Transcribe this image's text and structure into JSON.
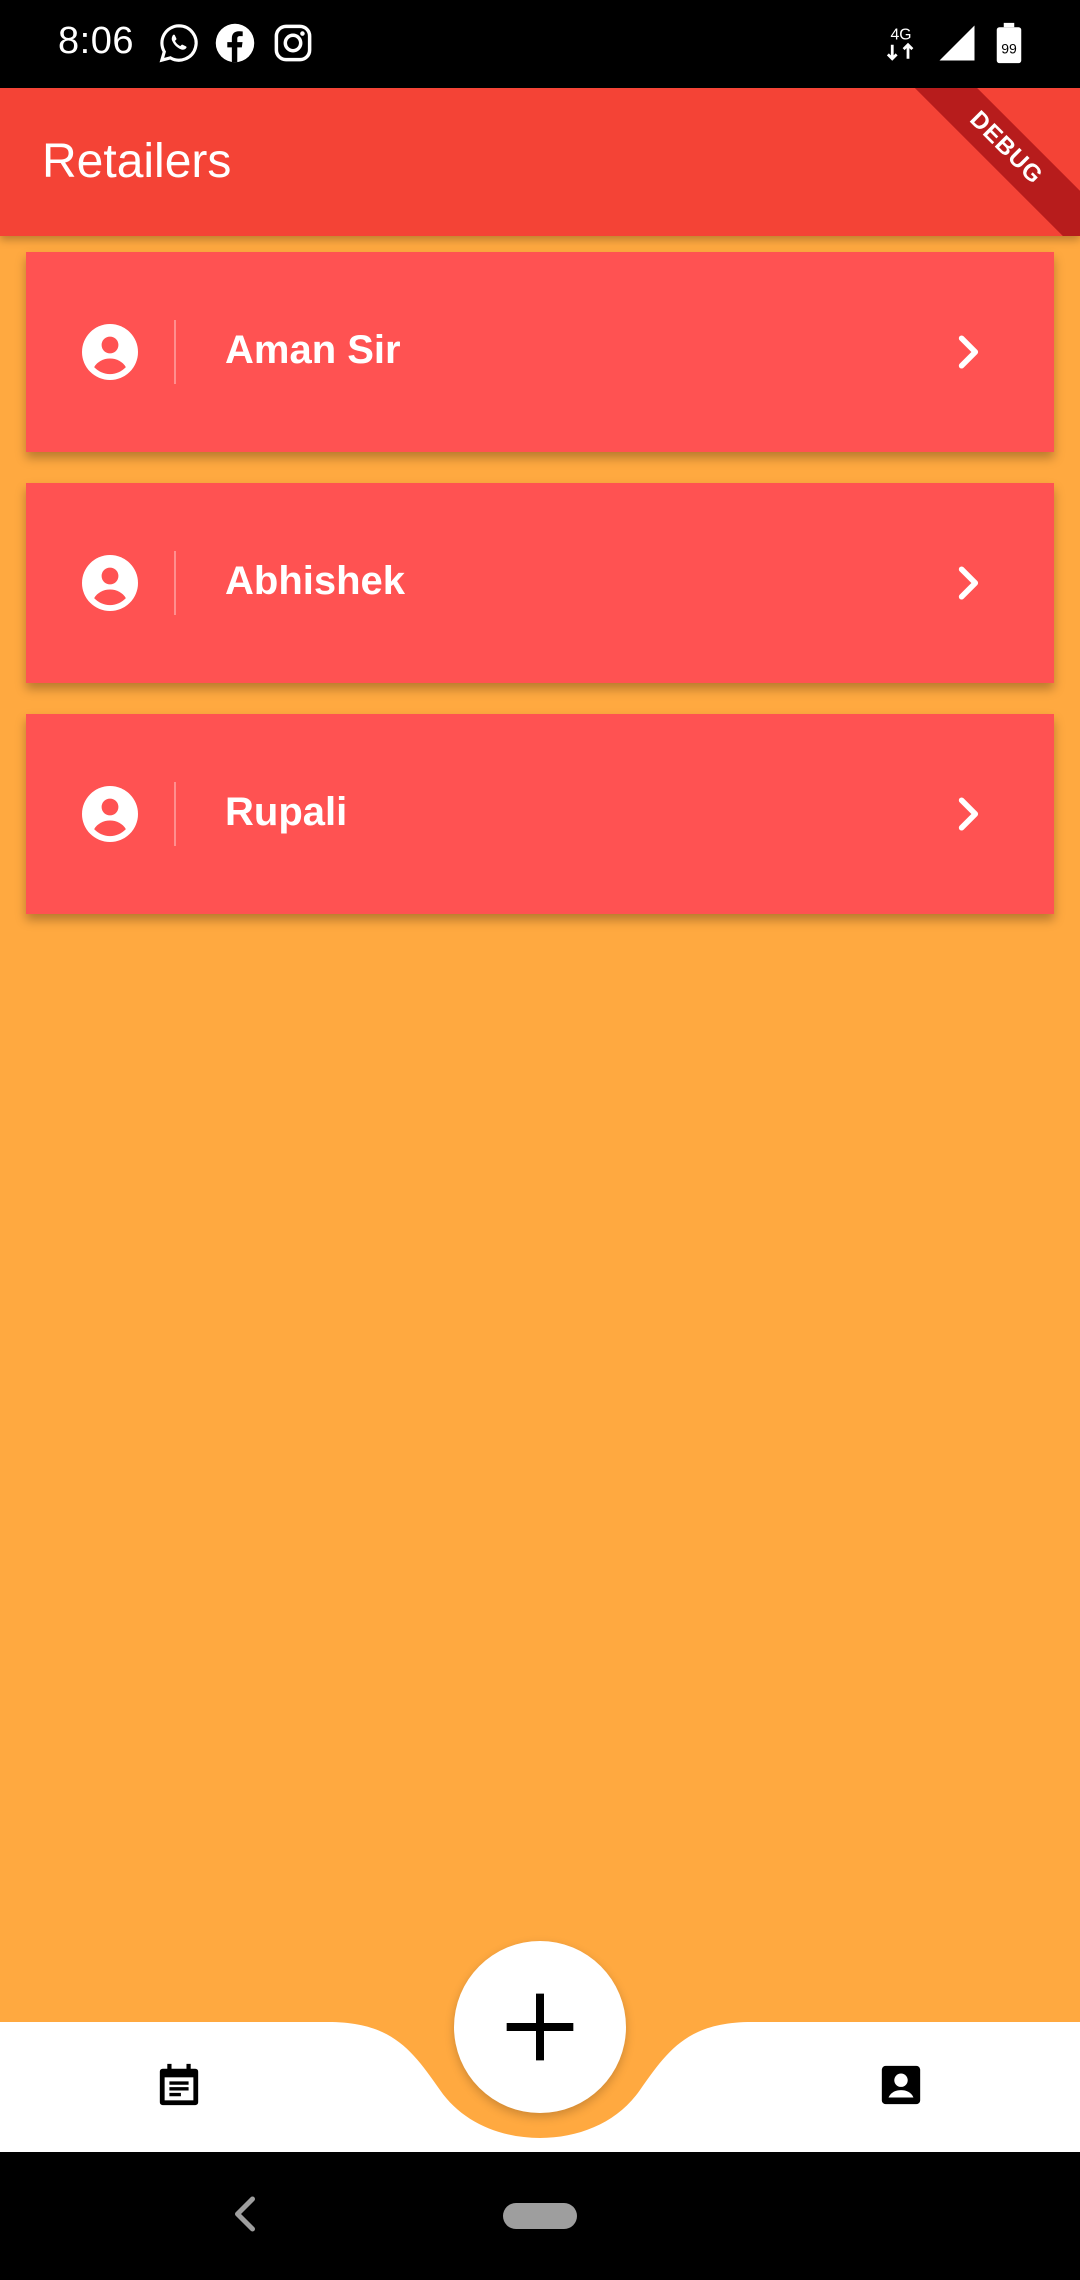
{
  "status_bar": {
    "time": "8:06",
    "app_icons": [
      "whatsapp-icon",
      "facebook-icon",
      "instagram-icon"
    ],
    "network": "4G",
    "battery": "99"
  },
  "app_bar": {
    "title": "Retailers",
    "debug_label": "DEBUG"
  },
  "retailers": [
    {
      "name": "Aman Sir"
    },
    {
      "name": "Abhishek"
    },
    {
      "name": "Rupali"
    }
  ],
  "bottom_nav": {
    "left_icon": "calendar-icon",
    "center_icon": "add-icon",
    "right_icon": "contact-icon"
  },
  "colors": {
    "app_bar": "#f44336",
    "background": "#ffa940",
    "card": "#ff5252",
    "debug_banner": "#b71c1c"
  }
}
